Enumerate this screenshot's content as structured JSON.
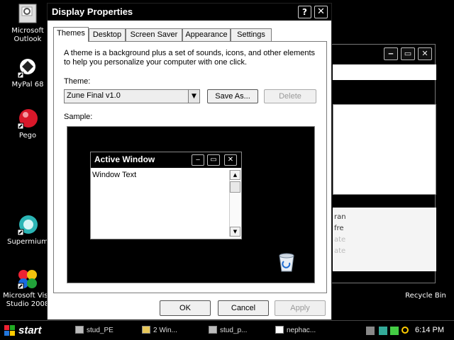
{
  "desktop": {
    "icons": [
      {
        "label": "Microsoft\nOutlook",
        "icon": "outlook-icon"
      },
      {
        "label": "MyPal 68",
        "icon": "mypal-icon"
      },
      {
        "label": "Pego",
        "icon": "pego-icon"
      },
      {
        "label": "Supermium",
        "icon": "supermium-icon"
      },
      {
        "label": "Microsoft Visu\nStudio 2008",
        "icon": "visual-studio-icon"
      },
      {
        "label": "Recycle Bin",
        "icon": "recycle-bin-icon"
      }
    ]
  },
  "background_window": {
    "snippets": [
      "ran",
      "fre",
      "ate",
      "ate",
      "ate",
      "ate"
    ]
  },
  "dialog": {
    "title": "Display Properties",
    "help_label": "?",
    "close_label": "✕",
    "tabs": [
      "Themes",
      "Desktop",
      "Screen Saver",
      "Appearance",
      "Settings"
    ],
    "active_tab": "Themes",
    "description": "A theme is a background plus a set of sounds, icons, and other elements to help you personalize your computer with one click.",
    "theme_label": "Theme:",
    "theme_value": "Zune Final v1.0",
    "save_as_label": "Save As...",
    "delete_label": "Delete",
    "sample_label": "Sample:",
    "sample_window": {
      "title": "Active Window",
      "text": "Window Text"
    },
    "ok_label": "OK",
    "cancel_label": "Cancel",
    "apply_label": "Apply"
  },
  "taskbar": {
    "start_label": "start",
    "tasks": [
      "stud_PE",
      "2 Win...",
      "stud_p...",
      "nephac..."
    ],
    "clock": "6:14 PM"
  },
  "colors": {
    "titlebar": "#000000",
    "desktop": "#000000",
    "dialog_bg": "#ffffff"
  }
}
